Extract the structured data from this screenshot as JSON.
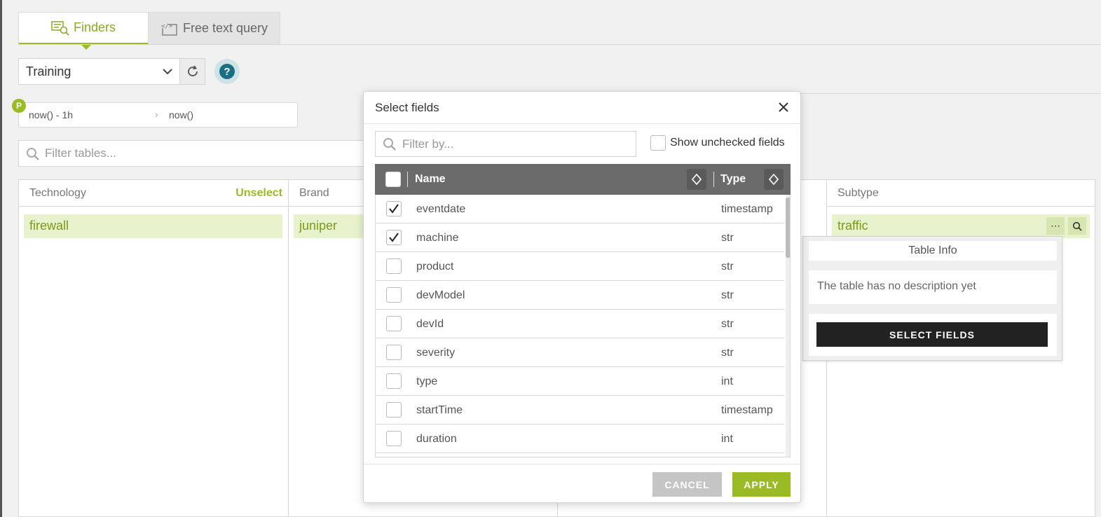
{
  "tabs": [
    {
      "label": "Finders",
      "icon": "finders-icon",
      "active": true
    },
    {
      "label": "Free text query",
      "icon": "code-icon",
      "active": false
    }
  ],
  "domain_select": {
    "value": "Training"
  },
  "daterange": {
    "badge": "P",
    "from": "now() - 1h",
    "to": "now()"
  },
  "filter_tables": {
    "placeholder": "Filter tables..."
  },
  "columns": {
    "technology": {
      "header": "Technology",
      "unselect": "Unselect",
      "item": "firewall"
    },
    "brand": {
      "header": "Brand",
      "item": "juniper"
    },
    "subtype": {
      "header": "Subtype",
      "item": "traffic"
    }
  },
  "table_info": {
    "title": "Table Info",
    "description": "The table has no description yet",
    "button": "SELECT FIELDS"
  },
  "modal": {
    "title": "Select fields",
    "filter_placeholder": "Filter by...",
    "show_unchecked": "Show unchecked fields",
    "col_name": "Name",
    "col_type": "Type",
    "rows": [
      {
        "name": "eventdate",
        "type": "timestamp",
        "checked": true
      },
      {
        "name": "machine",
        "type": "str",
        "checked": true
      },
      {
        "name": "product",
        "type": "str",
        "checked": false
      },
      {
        "name": "devModel",
        "type": "str",
        "checked": false
      },
      {
        "name": "devId",
        "type": "str",
        "checked": false
      },
      {
        "name": "severity",
        "type": "str",
        "checked": false
      },
      {
        "name": "type",
        "type": "int",
        "checked": false
      },
      {
        "name": "startTime",
        "type": "timestamp",
        "checked": false
      },
      {
        "name": "duration",
        "type": "int",
        "checked": false
      }
    ],
    "cancel": "CANCEL",
    "apply": "APPLY"
  },
  "colors": {
    "accent": "#9bbb24",
    "header": "#6b6b6b",
    "dark_button": "#222222"
  }
}
